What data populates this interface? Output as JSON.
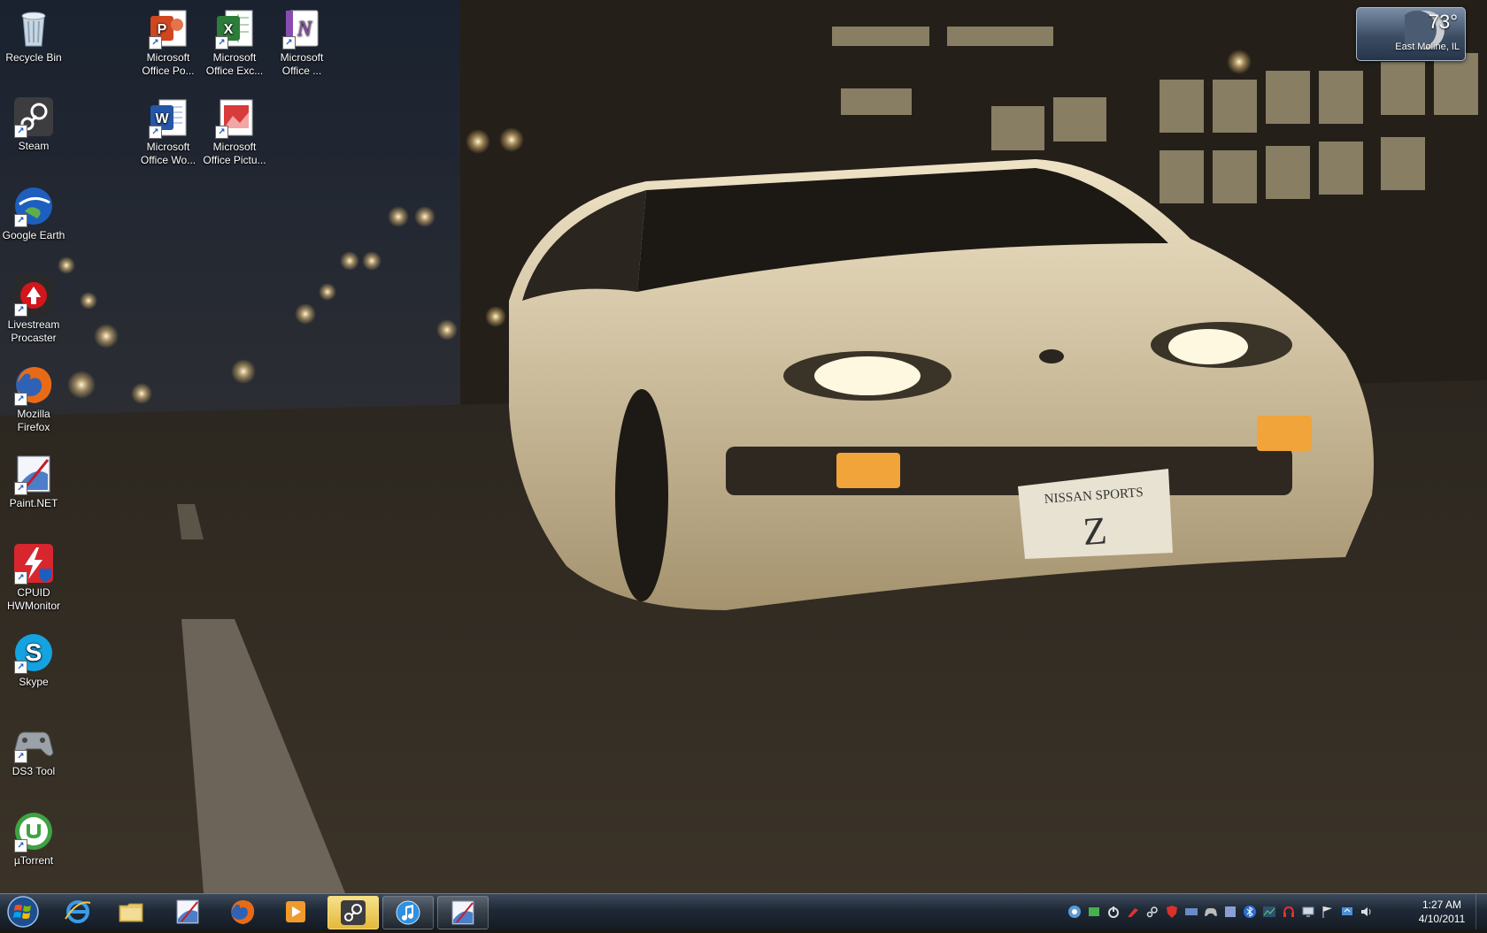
{
  "desktop": {
    "icons": [
      {
        "label": "Recycle Bin",
        "icon": "recycle-bin-icon"
      },
      {
        "label": "Steam",
        "icon": "steam-icon"
      },
      {
        "label": "Google Earth",
        "icon": "google-earth-icon"
      },
      {
        "label": "Livestream Procaster",
        "icon": "livestream-procaster-icon"
      },
      {
        "label": "Mozilla Firefox",
        "icon": "firefox-icon"
      },
      {
        "label": "Paint.NET",
        "icon": "paint-net-icon"
      },
      {
        "label": "CPUID HWMonitor",
        "icon": "hwmonitor-icon"
      },
      {
        "label": "Skype",
        "icon": "skype-icon"
      },
      {
        "label": "DS3 Tool",
        "icon": "gamepad-icon"
      },
      {
        "label": "µTorrent",
        "icon": "utorrent-icon"
      },
      {
        "label": "Microsoft Office Po...",
        "icon": "powerpoint-icon"
      },
      {
        "label": "Microsoft Office Exc...",
        "icon": "excel-icon"
      },
      {
        "label": "Microsoft Office ...",
        "icon": "onenote-icon"
      },
      {
        "label": "Microsoft Office Wo...",
        "icon": "word-icon"
      },
      {
        "label": "Microsoft Office Pictu...",
        "icon": "picture-manager-icon"
      }
    ]
  },
  "wallpaper": {
    "plate_line1": "NISSAN SPORTS",
    "plate_line2": "Z"
  },
  "weather": {
    "temperature": "73°",
    "location": "East Moline, IL"
  },
  "taskbar": {
    "pinned": [
      {
        "icon": "internet-explorer-icon"
      },
      {
        "icon": "windows-explorer-icon"
      },
      {
        "icon": "paint-net-icon"
      },
      {
        "icon": "firefox-icon"
      },
      {
        "icon": "media-player-icon"
      },
      {
        "icon": "steam-icon",
        "state": "active"
      },
      {
        "icon": "itunes-icon",
        "state": "open"
      },
      {
        "icon": "paint-net-icon",
        "state": "open"
      }
    ],
    "tray_icons": [
      "tray-steam-icon",
      "tray-green-icon",
      "tray-power-icon",
      "tray-red-tool-icon",
      "tray-steam-icon",
      "tray-shield-icon",
      "tray-network-card-icon",
      "tray-gamepad-icon",
      "tray-app-icon",
      "tray-bluetooth-icon",
      "tray-graph-icon",
      "tray-headset-icon",
      "tray-network-icon",
      "tray-flag-icon",
      "tray-update-icon",
      "tray-volume-icon"
    ],
    "clock_time": "1:27 AM",
    "clock_date": "4/10/2011"
  },
  "colors": {
    "taskbar_active": "#e4b83a",
    "car_body": "#d8c8a6"
  }
}
